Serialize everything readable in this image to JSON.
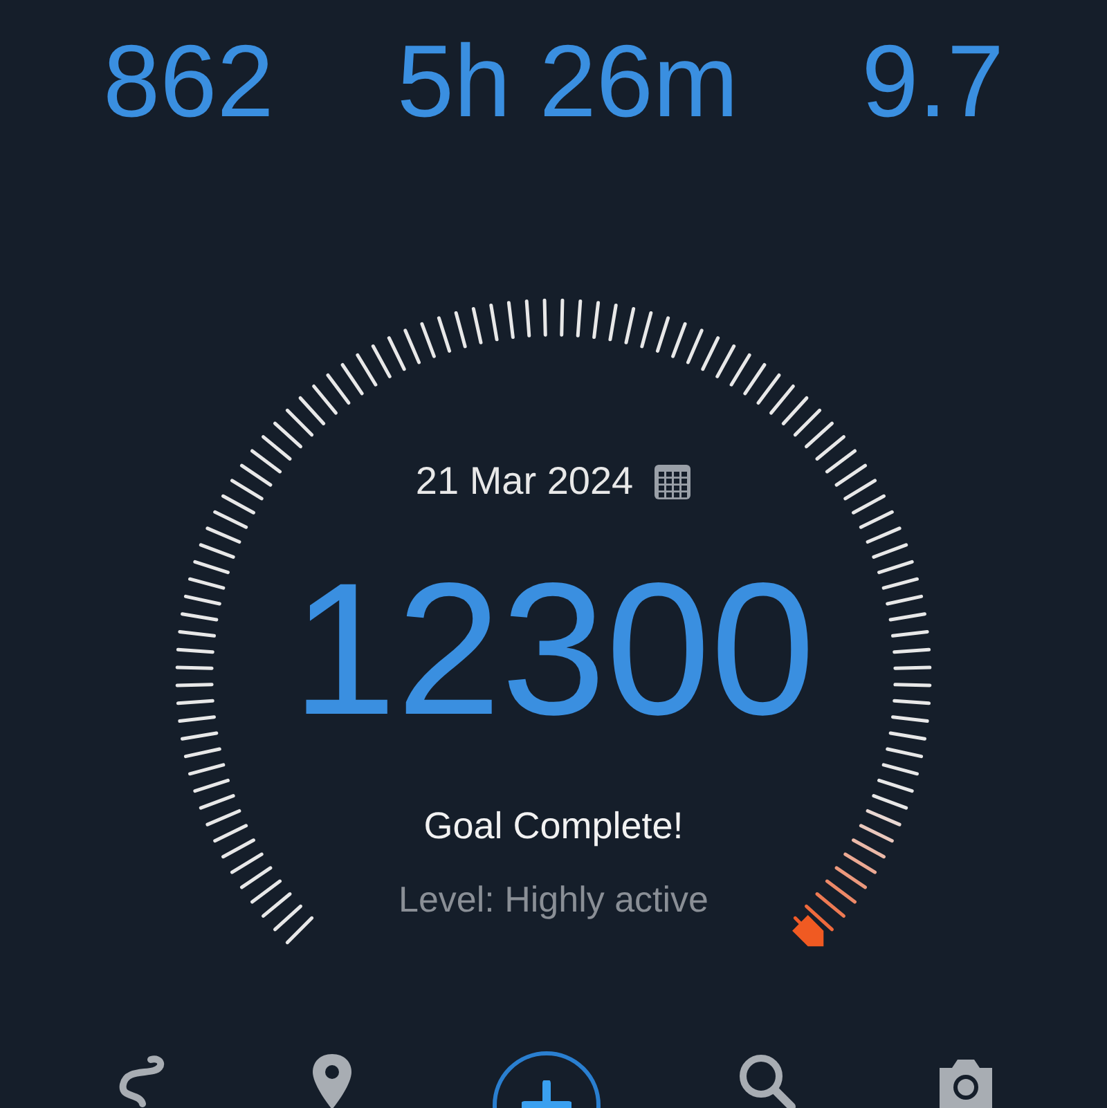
{
  "stats": [
    {
      "value": "862"
    },
    {
      "value": "5h 26m"
    },
    {
      "value": "9.7"
    }
  ],
  "gauge": {
    "date": "21 Mar 2024",
    "steps": "12300",
    "status": "Goal Complete!",
    "level_text": "Level: Highly active"
  },
  "nav": [
    {
      "kind": "route"
    },
    {
      "kind": "pin"
    },
    {
      "kind": "add"
    },
    {
      "kind": "search"
    },
    {
      "kind": "camera"
    }
  ]
}
